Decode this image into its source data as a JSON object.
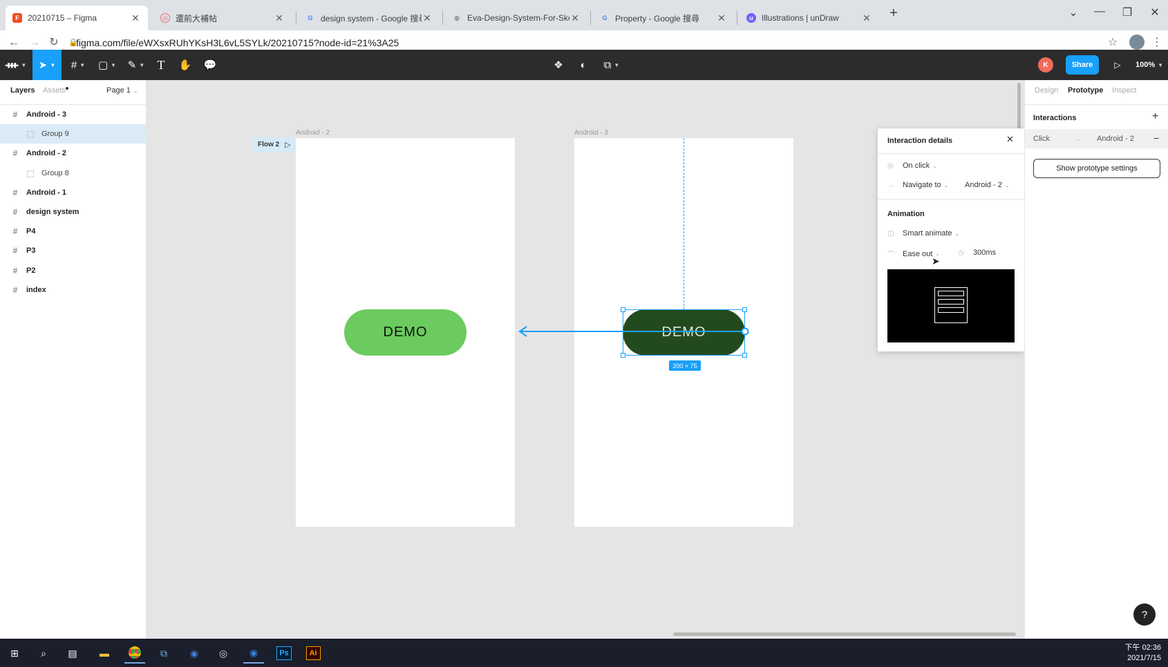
{
  "browser": {
    "tabs": [
      {
        "title": "20210715 – Figma",
        "active": true
      },
      {
        "title": "還前大補帖",
        "active": false
      },
      {
        "title": "design system - Google 搜尋",
        "active": false
      },
      {
        "title": "Eva-Design-System-For-Sketch",
        "active": false
      },
      {
        "title": "Property - Google 搜尋",
        "active": false
      },
      {
        "title": "Illustrations | unDraw",
        "active": false
      }
    ],
    "new_tab": "+",
    "url": "figma.com/file/eWXsxRUhYKsH3L6vL5SYLk/20210715?node-id=21%3A25"
  },
  "toolbar": {
    "avatar_initial": "K",
    "share_label": "Share",
    "zoom": "100%"
  },
  "left_panel": {
    "tabs": {
      "layers": "Layers",
      "assets": "Assets"
    },
    "page": "Page 1",
    "layers": [
      {
        "name": "Android - 3",
        "kind": "frame"
      },
      {
        "name": "Group 9",
        "kind": "group",
        "selected": true
      },
      {
        "name": "Android - 2",
        "kind": "frame"
      },
      {
        "name": "Group 8",
        "kind": "group"
      },
      {
        "name": "Android - 1",
        "kind": "frame"
      },
      {
        "name": "design system",
        "kind": "frame"
      },
      {
        "name": "P4",
        "kind": "frame"
      },
      {
        "name": "P3",
        "kind": "frame"
      },
      {
        "name": "P2",
        "kind": "frame"
      },
      {
        "name": "index",
        "kind": "frame"
      }
    ]
  },
  "canvas": {
    "frame_left_label": "Android - 2",
    "frame_right_label": "Android - 3",
    "flow_label": "Flow 2",
    "button_left_text": "DEMO",
    "button_right_text": "DEMO",
    "size_badge": "200 × 75"
  },
  "popup": {
    "title": "Interaction details",
    "trigger": "On click",
    "action": "Navigate to",
    "destination": "Android - 2",
    "animation_heading": "Animation",
    "animation_type": "Smart animate",
    "easing": "Ease out",
    "duration": "300ms"
  },
  "right_panel": {
    "tabs": {
      "design": "Design",
      "prototype": "Prototype",
      "inspect": "Inspect"
    },
    "interactions_heading": "Interactions",
    "interaction_trigger": "Click",
    "interaction_target": "Android - 2",
    "settings_button": "Show prototype settings"
  },
  "help": "?",
  "taskbar": {
    "time": "下午 02:36",
    "date": "2021/7/15"
  },
  "colors": {
    "figma_blue": "#18a0fb",
    "demo_light": "#6bcb5e",
    "demo_dark": "#234a1f",
    "toolbar_bg": "#2c2c2c"
  }
}
